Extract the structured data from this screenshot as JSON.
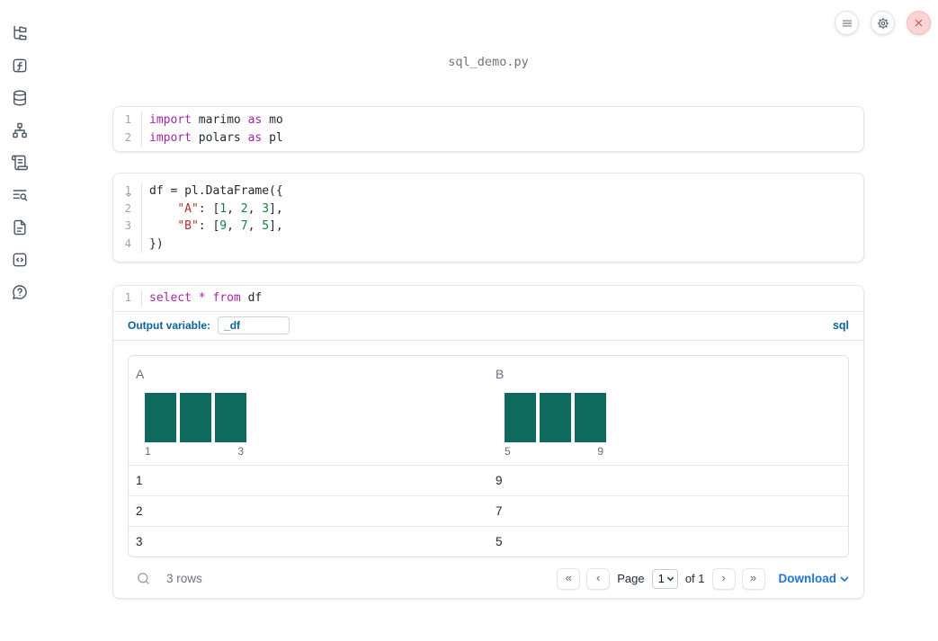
{
  "colors": {
    "keyword": "#a626a4",
    "string": "#b02f26",
    "number": "#1a7a46",
    "code_text": "#24292f",
    "label_blue": "#0b6399",
    "link_blue": "#2273d8",
    "histogram_bar": "#0e6a5c",
    "close_red": "#cf4444",
    "sidebar_icon": "#4a5568"
  },
  "sidebar": {
    "items": [
      {
        "name": "file-explorer",
        "icon": "file-tree-icon"
      },
      {
        "name": "variables",
        "icon": "function-square-icon"
      },
      {
        "name": "data-sources",
        "icon": "database-icon"
      },
      {
        "name": "dependency-graph",
        "icon": "org-chart-icon"
      },
      {
        "name": "outline",
        "icon": "scroll-icon"
      },
      {
        "name": "logs",
        "icon": "list-search-icon"
      },
      {
        "name": "documentation",
        "icon": "document-icon"
      },
      {
        "name": "snippets",
        "icon": "code-square-icon"
      },
      {
        "name": "help",
        "icon": "help-bubble-icon"
      }
    ]
  },
  "topbar": {
    "buttons": [
      {
        "name": "menu",
        "icon": "hamburger-icon"
      },
      {
        "name": "settings",
        "icon": "gear-icon"
      },
      {
        "name": "shutdown",
        "icon": "close-icon"
      }
    ]
  },
  "header": {
    "filename": "sql_demo.py"
  },
  "cells": {
    "imports": {
      "nums": [
        "1",
        "2"
      ],
      "l1": [
        "import",
        " marimo ",
        "as",
        " mo"
      ],
      "l2": [
        "import",
        " polars ",
        "as",
        " pl"
      ]
    },
    "dataframe": {
      "nums": [
        "1",
        "2",
        "3",
        "4"
      ],
      "l1": "df = pl.DataFrame({",
      "l2": [
        "    ",
        "\"A\"",
        ": [",
        "1",
        ", ",
        "2",
        ", ",
        "3",
        "],"
      ],
      "l3": [
        "    ",
        "\"B\"",
        ": [",
        "9",
        ", ",
        "7",
        ", ",
        "5",
        "],"
      ],
      "l4": "})"
    },
    "sql": {
      "nums": [
        "1"
      ],
      "tokens": [
        "select",
        " ",
        "*",
        " ",
        "from",
        " df"
      ],
      "outvar_label": "Output variable:",
      "outvar_value": "_df",
      "lang_label": "sql"
    }
  },
  "output": {
    "chart_data": [
      {
        "type": "bar",
        "column": "A",
        "categories": [
          "1",
          "2",
          "3"
        ],
        "values": [
          1,
          1,
          1
        ],
        "x_min_label": "1",
        "x_max_label": "3"
      },
      {
        "type": "bar",
        "column": "B",
        "categories": [
          "5",
          "7",
          "9"
        ],
        "values": [
          1,
          1,
          1
        ],
        "x_min_label": "5",
        "x_max_label": "9"
      }
    ],
    "table": {
      "columns": [
        {
          "label": "A"
        },
        {
          "label": "B"
        }
      ],
      "rows": [
        [
          "1",
          "9"
        ],
        [
          "2",
          "7"
        ],
        [
          "3",
          "5"
        ]
      ]
    },
    "footer": {
      "row_count": "3 rows",
      "first": "«",
      "prev": "‹",
      "next": "›",
      "last": "»",
      "page_label": "Page",
      "page_value": "1",
      "of_label": "of 1",
      "download_label": "Download"
    }
  }
}
